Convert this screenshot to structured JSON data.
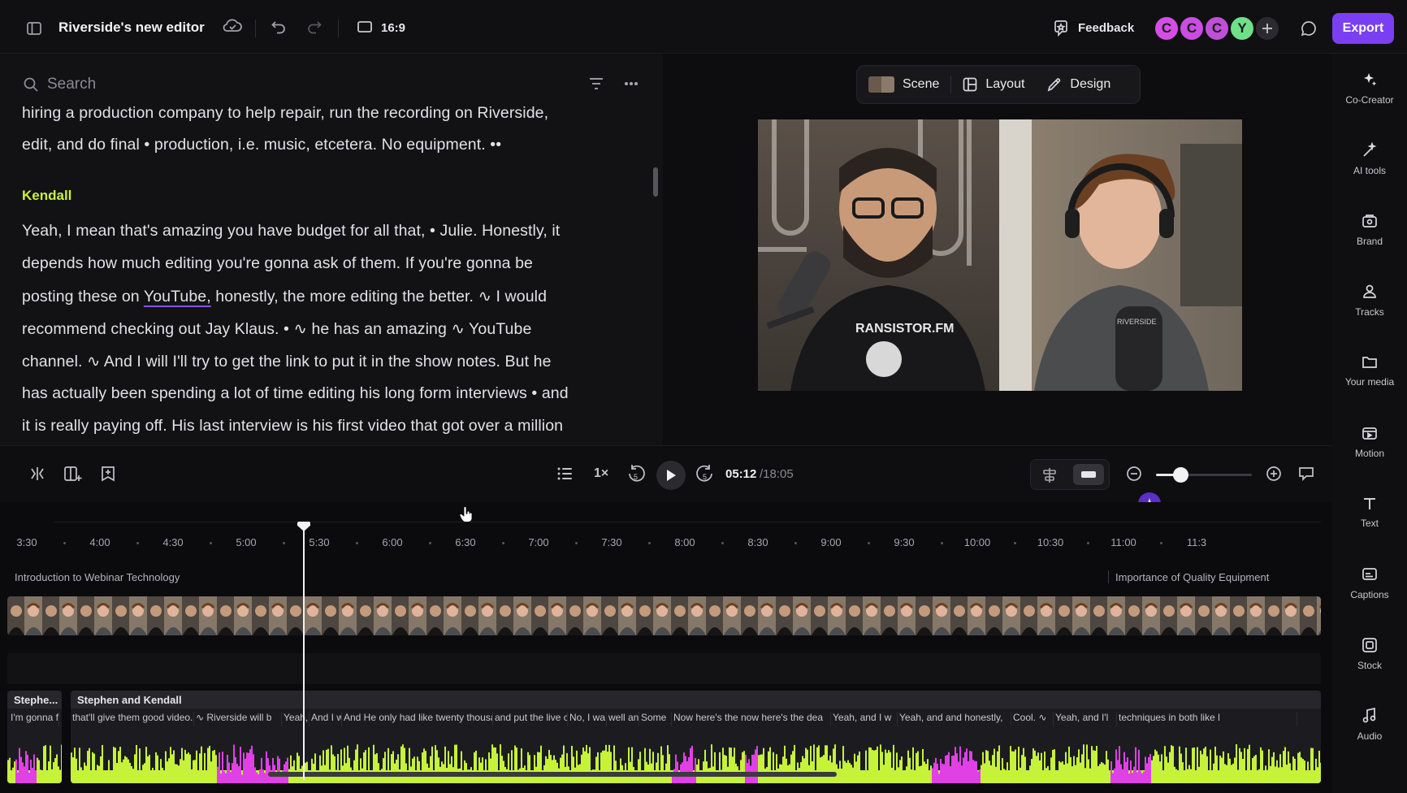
{
  "topbar": {
    "project_title": "Riverside's new editor",
    "aspect_ratio": "16:9",
    "feedback_label": "Feedback",
    "avatars": [
      {
        "letter": "C",
        "color": "#d54de6"
      },
      {
        "letter": "C",
        "color": "#c84de0"
      },
      {
        "letter": "C",
        "color": "#c04fd8"
      },
      {
        "letter": "Y",
        "color": "#6fe08a"
      }
    ],
    "export_label": "Export"
  },
  "transcript": {
    "search_placeholder": "Search",
    "lines_before": [
      "hiring a production company to help repair, run the recording on Riverside,",
      "edit, and do final • production, i.e. music, etcetera. No equipment. ••"
    ],
    "speaker": "Kendall",
    "paragraph": [
      "Yeah, I mean that's amazing you have budget for all that, • Julie. Honestly, it",
      "depends how much editing you're gonna ask of them. If you're gonna be",
      [
        "posting these on ",
        "YouTube,",
        " honestly, the more editing the better. ∿ I would"
      ],
      "recommend checking out Jay Klaus. • ∿ he has an amazing ∿ YouTube",
      "channel. ∿ And I will I'll try to get the link to put it in the show notes. But he",
      "has actually been spending a lot of time editing his long form interviews • and",
      "it is really paying off. His last interview is his first video that got over a million"
    ]
  },
  "preview": {
    "tabs": [
      {
        "label": "Scene",
        "icon": "scene-thumbnail-icon"
      },
      {
        "label": "Layout",
        "icon": "layout-icon"
      },
      {
        "label": "Design",
        "icon": "pen-icon"
      }
    ]
  },
  "rightbar": {
    "items": [
      {
        "label": "Co-Creator",
        "icon": "sparkle-icon"
      },
      {
        "label": "AI tools",
        "icon": "magic-wand-icon"
      },
      {
        "label": "Brand",
        "icon": "brand-icon"
      },
      {
        "label": "Tracks",
        "icon": "people-icon"
      },
      {
        "label": "Your media",
        "icon": "folder-icon"
      },
      {
        "label": "Motion",
        "icon": "motion-icon"
      },
      {
        "label": "Text",
        "icon": "text-icon"
      },
      {
        "label": "Captions",
        "icon": "captions-icon"
      },
      {
        "label": "Stock",
        "icon": "stock-icon"
      },
      {
        "label": "Audio",
        "icon": "music-note-icon"
      }
    ]
  },
  "controls": {
    "speed": "1×",
    "skip_back_seconds": "5",
    "skip_forward_seconds": "5",
    "current_time": "05:12",
    "total_time": "/18:05",
    "zoom_level": 0.25
  },
  "timeline": {
    "ticks": [
      "3:30",
      "4:00",
      "4:30",
      "5:00",
      "5:30",
      "6:00",
      "6:30",
      "7:00",
      "7:30",
      "8:00",
      "8:30",
      "9:00",
      "9:30",
      "10:00",
      "10:30",
      "11:00",
      "11:3"
    ],
    "chapters": [
      "Introduction to Webinar Technology",
      "Importance of Quality Equipment"
    ],
    "clips": [
      {
        "title": "Stephe...",
        "snippets": [
          "I'm gonna f"
        ]
      },
      {
        "title": "Stephen and Kendall",
        "snippets": [
          "that'll give them good video.",
          "∿ Riverside will b",
          "Yeah, I w",
          "And I w",
          "And He only had like twenty thousand sub",
          "and put the live c",
          "No, I wa",
          "well and",
          "Some",
          "Now here's the now here's the dea",
          "Yeah, and I w",
          "Yeah, and and honestly,",
          "Cool. ∿",
          "Yeah, and I'l",
          "techniques in both like l"
        ]
      }
    ]
  },
  "colors": {
    "accent": "#7b3ff2",
    "speaker": "#c8f03c",
    "wave_green": "#c6f23a",
    "wave_pink": "#e040e6"
  }
}
